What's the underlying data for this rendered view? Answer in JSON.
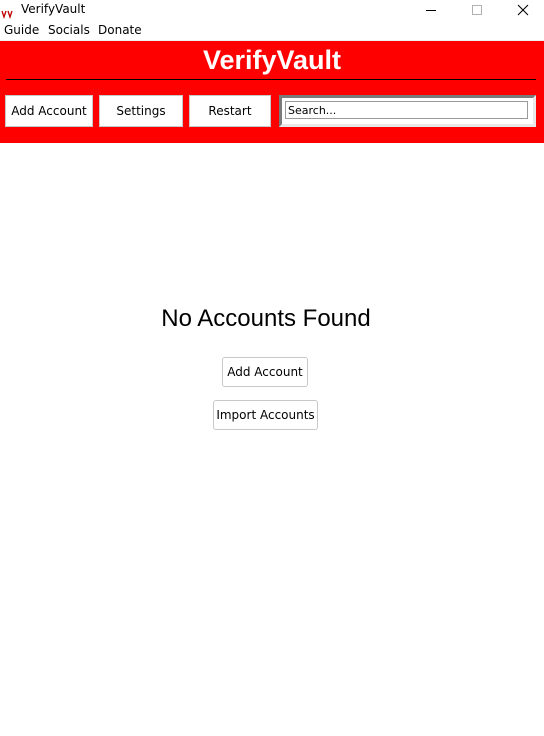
{
  "window": {
    "title": "VerifyVault"
  },
  "menu": {
    "items": [
      "Guide",
      "Socials",
      "Donate"
    ]
  },
  "header": {
    "title": "VerifyVault",
    "buttons": {
      "add_account": "Add Account",
      "settings": "Settings",
      "restart": "Restart"
    },
    "search": {
      "placeholder": "Search...",
      "value": ""
    }
  },
  "main": {
    "empty_message": "No Accounts Found",
    "add_account": "Add Account",
    "import_accounts": "Import Accounts"
  },
  "colors": {
    "header_bg": "#ff0000",
    "header_text": "#ffffff"
  },
  "icons": {
    "app": "verifyvault-app-icon",
    "minimize": "minimize-icon",
    "maximize": "maximize-icon",
    "close": "close-icon"
  }
}
